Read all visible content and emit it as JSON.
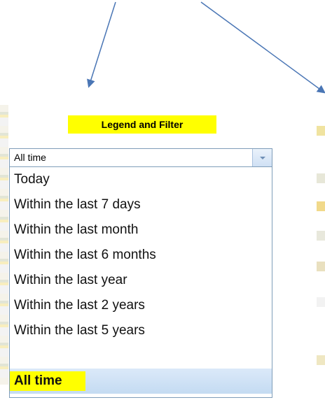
{
  "panel": {
    "title": "Legend and Filter"
  },
  "filter": {
    "selected_value": "All time",
    "options": [
      {
        "label": "Today"
      },
      {
        "label": "Within the last 7 days"
      },
      {
        "label": "Within the last month"
      },
      {
        "label": "Within the last 6 months"
      },
      {
        "label": "Within the last year"
      },
      {
        "label": "Within the last 2 years"
      },
      {
        "label": "Within the last 5 years"
      },
      {
        "label": "All time"
      }
    ],
    "selected_index": 7
  },
  "colors": {
    "highlight": "#ffff00",
    "arrow": "#4a76b5",
    "border": "#7f9db9",
    "selected_bg": "#cfe0f4"
  },
  "icons": {
    "dropdown": "chevron-down-icon",
    "arrow_left": "arrow-icon",
    "arrow_right": "arrow-icon"
  }
}
